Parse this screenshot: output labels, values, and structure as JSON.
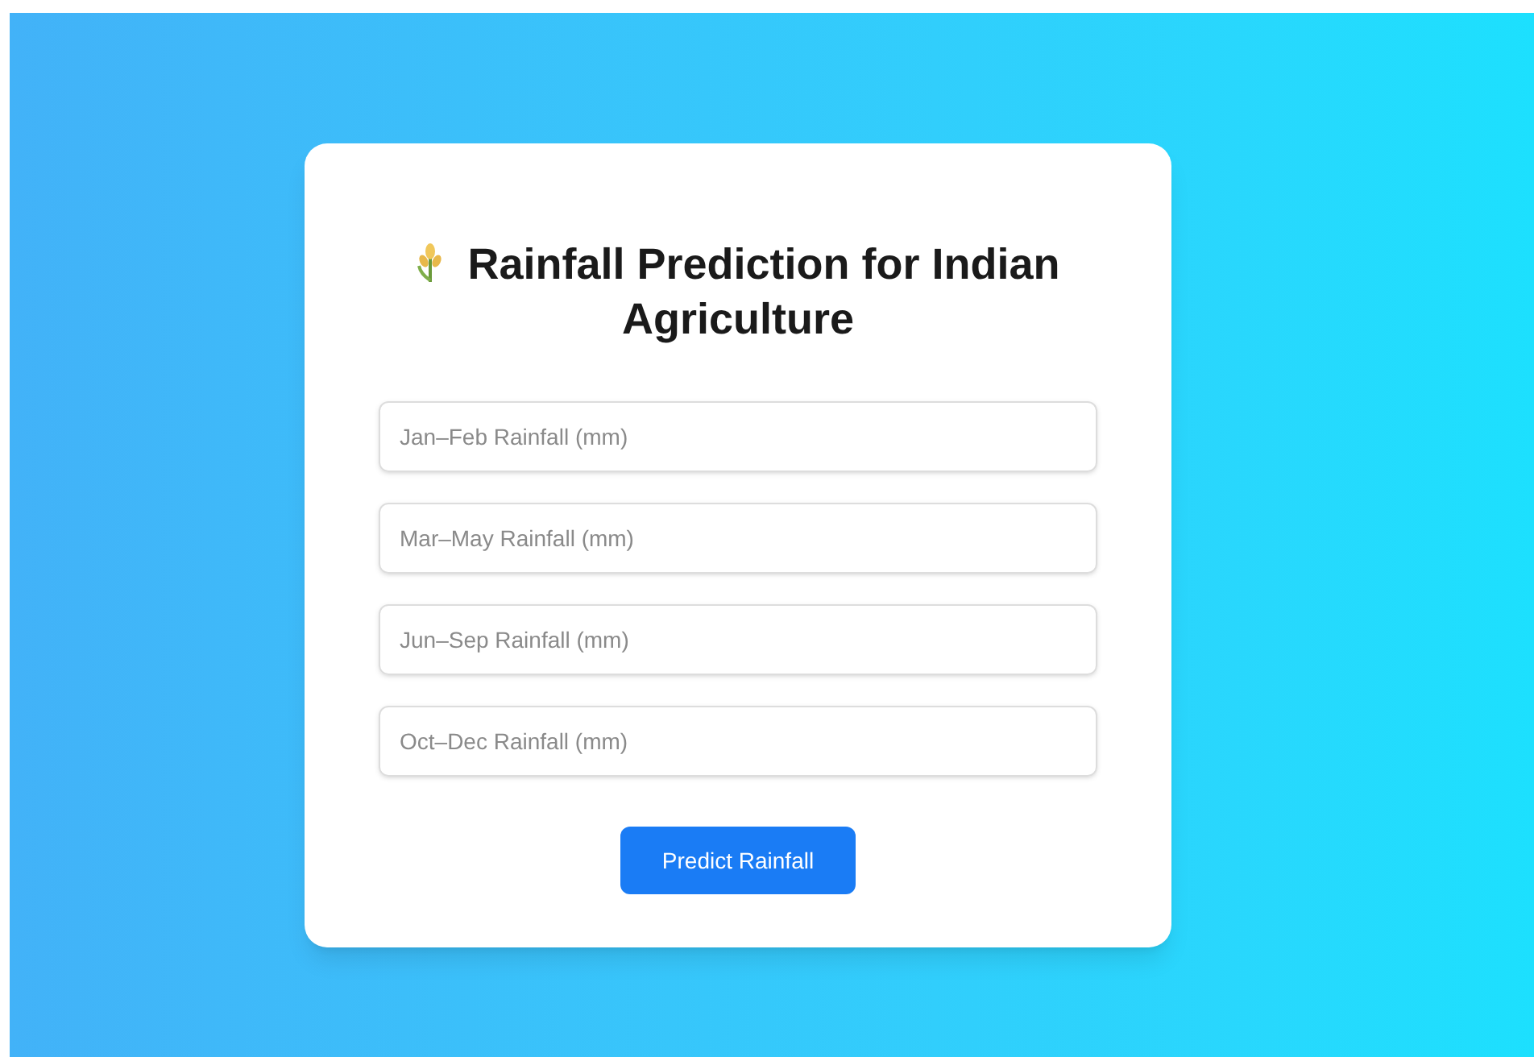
{
  "title": "Rainfall Prediction for Indian Agriculture",
  "fields": [
    {
      "placeholder": "Jan–Feb Rainfall (mm)"
    },
    {
      "placeholder": "Mar–May Rainfall (mm)"
    },
    {
      "placeholder": "Jun–Sep Rainfall (mm)"
    },
    {
      "placeholder": "Oct–Dec Rainfall (mm)"
    }
  ],
  "button": "Predict Rainfall"
}
